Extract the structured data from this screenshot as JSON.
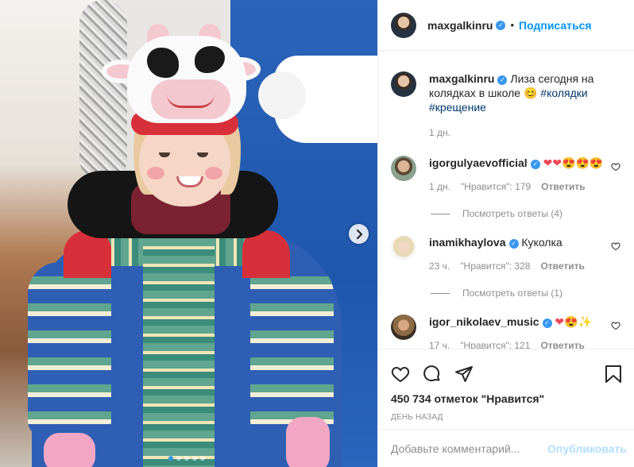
{
  "post": {
    "author": "maxgalkinru",
    "follow_label": "Подписаться",
    "separator": "•",
    "caption": {
      "username": "maxgalkinru",
      "text": "Лиза сегодня на колядках в школе 😊",
      "hashtags": [
        "#колядки",
        "#крещение"
      ],
      "time": "1 дн."
    },
    "comments": [
      {
        "username": "igorgulyaevofficial",
        "text": "❤❤😍😍😍",
        "time": "1 дн.",
        "likes": "\"Нравится\": 179",
        "reply_label": "Ответить",
        "view_replies": "Посмотреть ответы (4)"
      },
      {
        "username": "inamikhaylova",
        "text": "Куколка",
        "time": "23 ч.",
        "likes": "\"Нравится\": 328",
        "reply_label": "Ответить",
        "view_replies": "Посмотреть ответы (1)"
      },
      {
        "username": "igor_nikolaev_music",
        "text": "❤😍✨",
        "time": "17 ч.",
        "likes": "\"Нравится\": 121",
        "reply_label": "Ответить"
      }
    ],
    "likes_count": "450 734 отметок \"Нравится\"",
    "posted_ago": "День назад",
    "comment_placeholder": "Добавьте комментарий...",
    "publish_label": "Опубликовать",
    "carousel": {
      "slides": 5,
      "active": 1
    }
  },
  "colors": {
    "accent": "#0095f6",
    "verified": "#3897f0",
    "like_red": "#ed4956",
    "muted": "#8e8e8e",
    "publish_disabled": "#b2dffc"
  }
}
